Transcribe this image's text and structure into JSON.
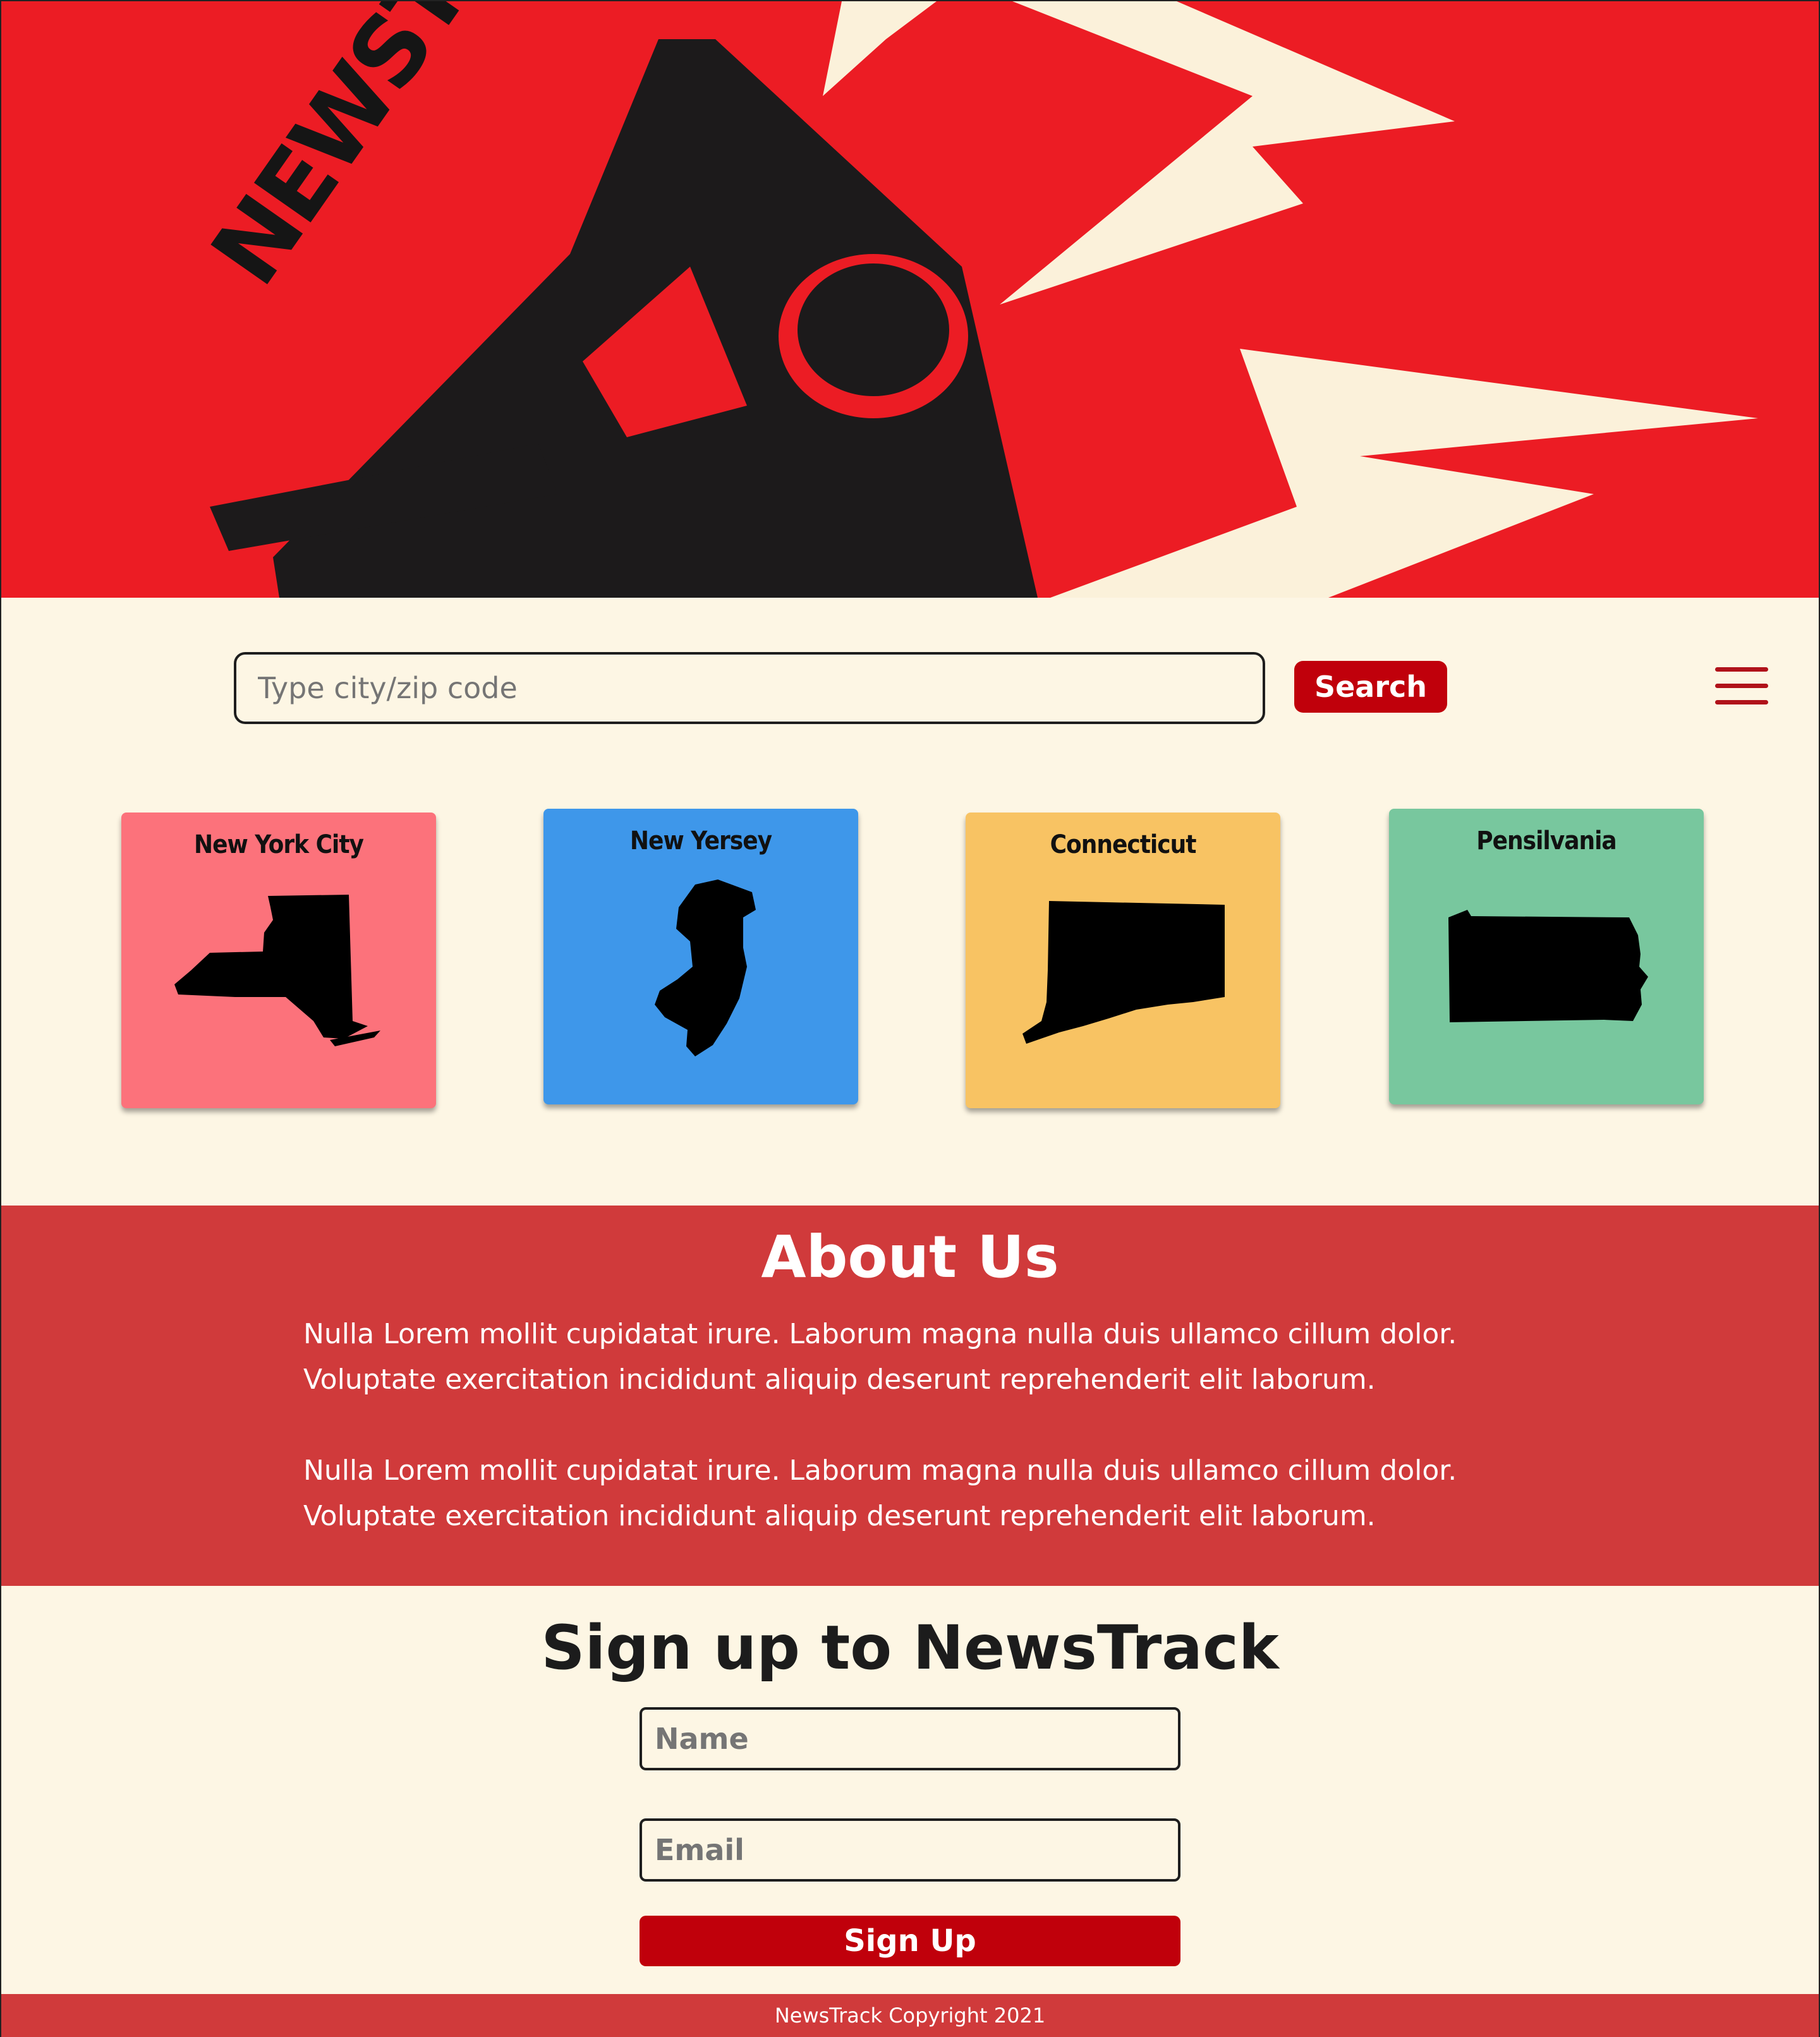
{
  "hero": {
    "title": "NEWSTRACK"
  },
  "search": {
    "placeholder": "Type city/zip code",
    "button_label": "Search"
  },
  "regions": [
    {
      "label": "New York City",
      "color": "#fc727b",
      "icon": "new-york-map-icon"
    },
    {
      "label": "New Yersey",
      "color": "#3e97ea",
      "icon": "new-jersey-map-icon"
    },
    {
      "label": "Connecticut",
      "color": "#f8c363",
      "icon": "connecticut-map-icon"
    },
    {
      "label": "Pensilvania",
      "color": "#78c79e",
      "icon": "pennsylvania-map-icon"
    }
  ],
  "about": {
    "title": "About Us",
    "paragraphs": [
      "Nulla Lorem mollit cupidatat irure. Laborum magna nulla duis ullamco cillum dolor. Voluptate exercitation incididunt aliquip deserunt reprehenderit elit laborum.",
      "Nulla Lorem mollit cupidatat irure. Laborum magna nulla duis ullamco cillum dolor. Voluptate exercitation incididunt aliquip deserunt reprehenderit elit laborum."
    ]
  },
  "signup": {
    "title": "Sign up to NewsTrack",
    "name_placeholder": "Name",
    "email_placeholder": "Email",
    "button_label": "Sign Up"
  },
  "footer": {
    "text": "NewsTrack Copyright 2021"
  },
  "colors": {
    "accent": "#c0000b",
    "background": "#fdf6e4",
    "section_red": "#d03a3b",
    "hero_red": "#ec1c24"
  }
}
